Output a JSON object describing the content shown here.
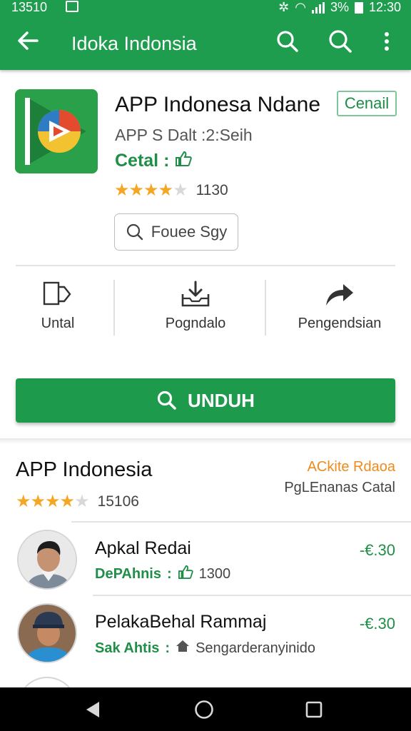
{
  "status_bar": {
    "time_left": "13510",
    "battery": "3%",
    "time": "12:30"
  },
  "app_bar": {
    "title": "Idoka Indonsia"
  },
  "app": {
    "name": "APP Indonesa Ndane",
    "cancel_label": "Cenail",
    "subtitle": "APP S Dalt :2:Seih",
    "status": "Cetal :",
    "rating": 4,
    "rating_count": "1130",
    "search_chip_label": "Fouee Sgy"
  },
  "actions": [
    {
      "label": "Untal",
      "icon": "copy-icon"
    },
    {
      "label": "Pogndalo",
      "icon": "download-tray-icon"
    },
    {
      "label": "Pengendsian",
      "icon": "share-arrow-icon"
    }
  ],
  "download_button": {
    "label": "UNDUH"
  },
  "section": {
    "title": "APP Indonesia",
    "link": "ACkite Rdaoa",
    "subtitle": "PgLEnanas Catal",
    "rating": 4,
    "rating_count": "15106"
  },
  "list": [
    {
      "name": "Apkal Redai",
      "developer": "DePAhnis",
      "separator": ":",
      "meta_icon": "thumbs-up-icon",
      "meta_value": "1300",
      "price": "-€.30"
    },
    {
      "name": "PelakaBehal Rammaj",
      "developer": "Sak Ahtis",
      "separator": ":",
      "meta_icon": "home-icon",
      "meta_value": "Sengarderanyinido",
      "price": "-€.30"
    }
  ],
  "colors": {
    "primary": "#1f9d4f",
    "accent": "#f08a1c",
    "star": "#f5a623"
  }
}
